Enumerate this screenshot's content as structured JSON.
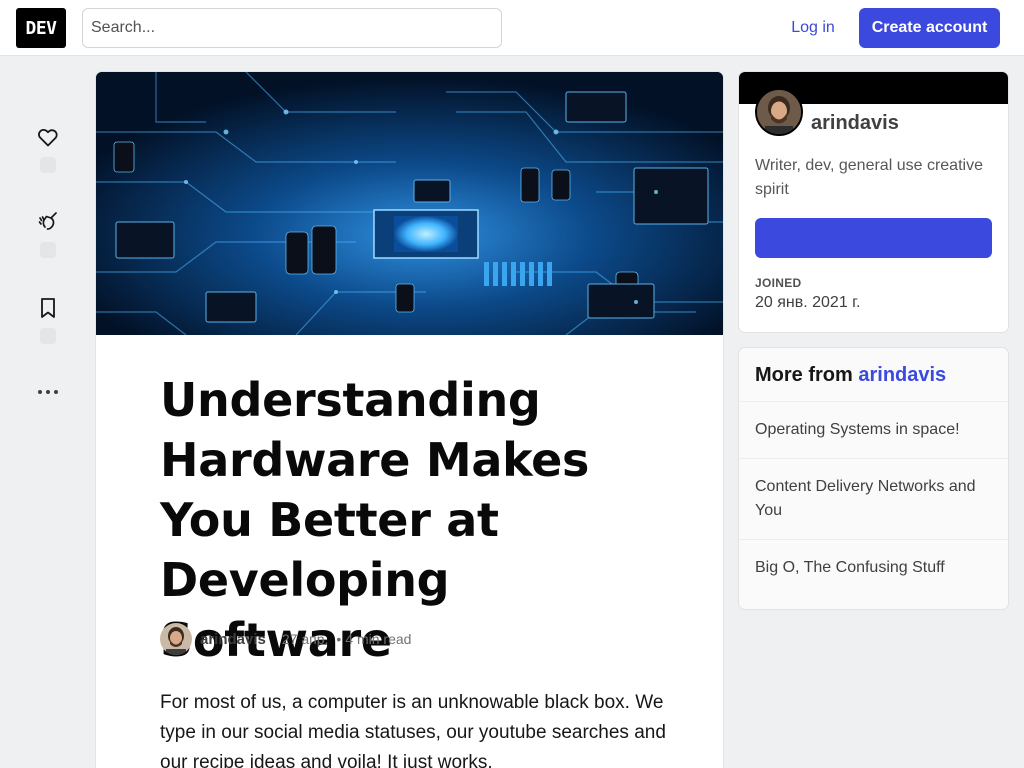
{
  "header": {
    "logo_text": "DEV",
    "search_placeholder": "Search...",
    "login_label": "Log in",
    "create_account_label": "Create account"
  },
  "reactions": {
    "heart_icon": "heart-icon",
    "unicorn_icon": "unicorn-icon",
    "bookmark_icon": "bookmark-icon",
    "more_icon": "more-horizontal-icon"
  },
  "article": {
    "title": "Understanding Hardware Makes You Better at Developing Software",
    "author": "arindavis",
    "date": "27 апр.",
    "separator": "•",
    "read_time": "4 min read",
    "body": "For most of us, a computer is an unknowable black box. We type in our social media statuses, our youtube searches and our recipe ideas and voila! It just works."
  },
  "profile": {
    "name": "arindavis",
    "bio": "Writer, dev, general use creative spirit",
    "follow_label": "",
    "joined_label": "JOINED",
    "joined_date": "20 янв. 2021 г."
  },
  "more_from": {
    "prefix": "More from",
    "name": "arindavis",
    "items": [
      "Operating Systems in space!",
      "Content Delivery Networks and You",
      "Big O, The Confusing Stuff"
    ]
  },
  "colors": {
    "brand": "#3b49df",
    "page_bg": "#eef0f1",
    "logo_bg": "#000000"
  }
}
